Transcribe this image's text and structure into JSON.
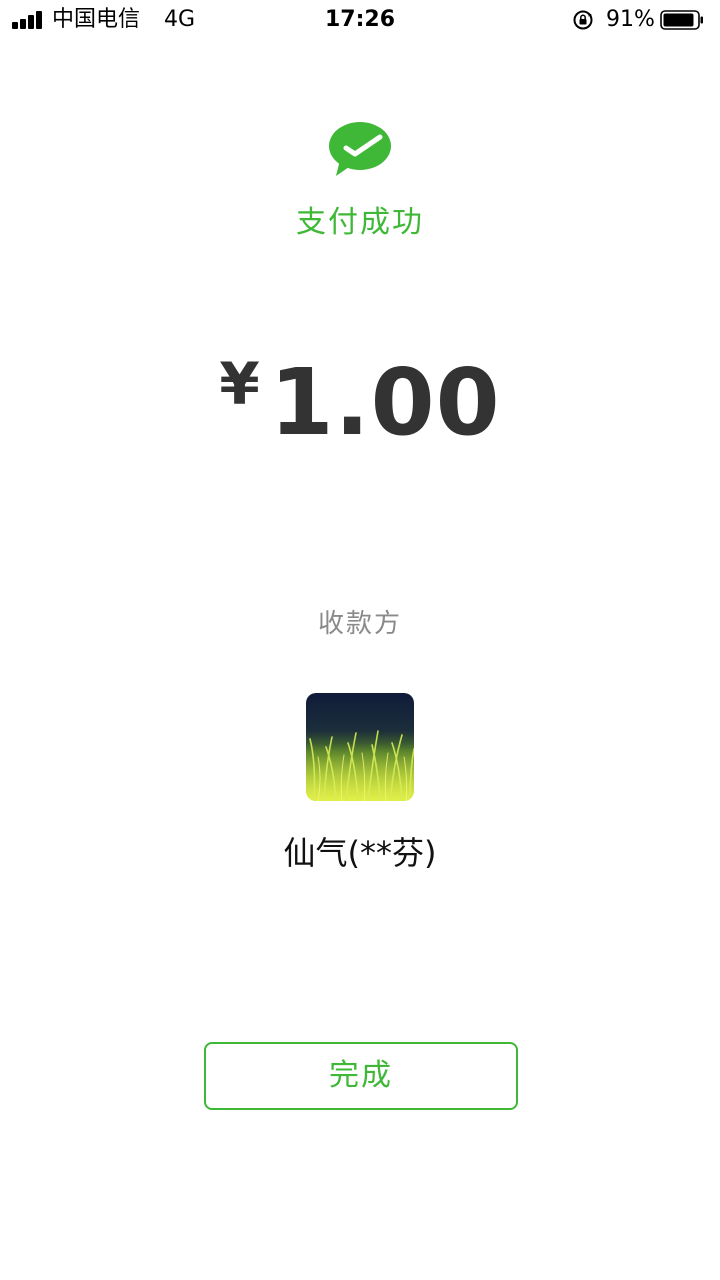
{
  "status_bar": {
    "carrier": "中国电信",
    "network": "4G",
    "time": "17:26",
    "battery_percent": "91%",
    "battery_level": 0.91,
    "signal_icon": "signal-bars-icon",
    "lock_icon": "rotation-lock-icon",
    "battery_icon": "battery-icon"
  },
  "payment": {
    "app_icon": "wechat-pay-icon",
    "status_text": "支付成功",
    "currency_symbol": "¥",
    "amount": "1.00",
    "payee_label": "收款方",
    "payee_avatar": "payee-avatar-grass-image",
    "payee_name": "仙气(**芬)"
  },
  "actions": {
    "done_label": "完成"
  },
  "colors": {
    "accent": "#3fb837",
    "amount_text": "#333333",
    "muted_text": "#8a8a8a",
    "background": "#ffffff"
  }
}
